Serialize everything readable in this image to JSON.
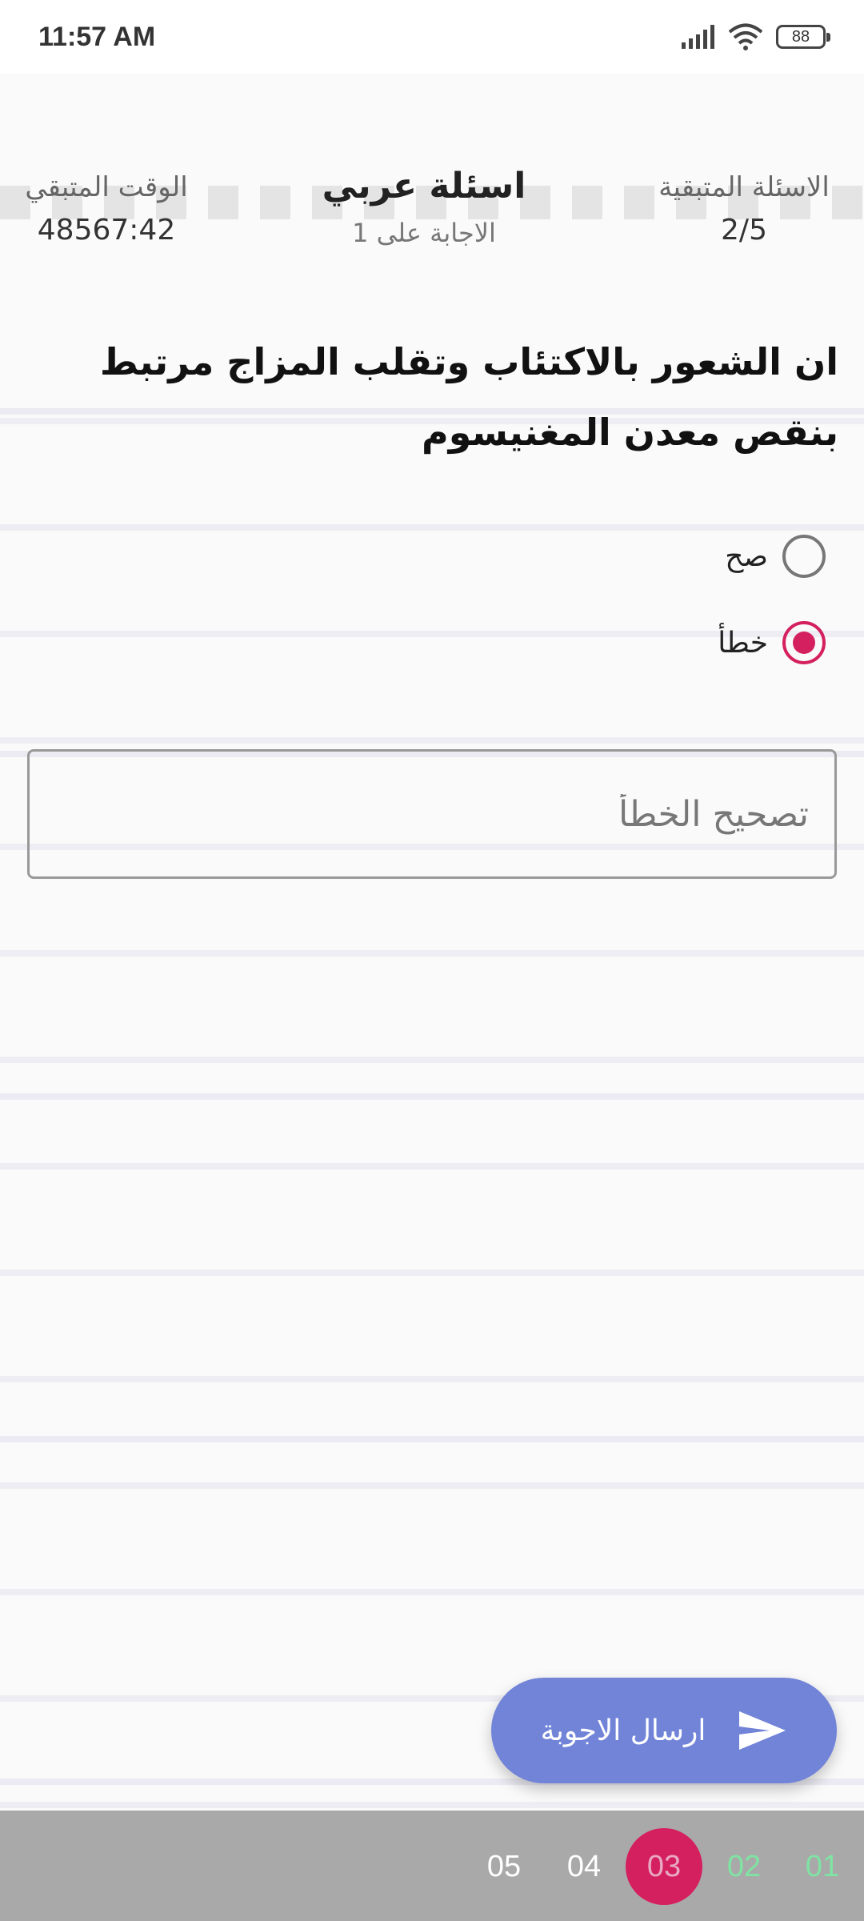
{
  "status_bar": {
    "time": "11:57 AM",
    "battery": "88"
  },
  "header": {
    "remaining_questions_label": "الاسئلة المتبقية",
    "remaining_questions_value": "2/5",
    "remaining_time_label": "الوقت المتبقي",
    "remaining_time_value": "48567:42",
    "title": "اسئلة عربي",
    "answer_note": "الاجابة على 1"
  },
  "question": {
    "text": "ان الشعور بالاكتئاب وتقلب المزاج مرتبط بنقص معدن المغنيسوم"
  },
  "options": [
    {
      "label": "صح",
      "selected": false
    },
    {
      "label": "خطأ",
      "selected": true
    }
  ],
  "correction": {
    "placeholder": "تصحيح الخطأ",
    "value": ""
  },
  "send_button": {
    "label": "ارسال الاجوبة",
    "icon": "send-icon"
  },
  "pages": [
    {
      "label": "05",
      "state": "todo"
    },
    {
      "label": "04",
      "state": "todo"
    },
    {
      "label": "03",
      "state": "current"
    },
    {
      "label": "02",
      "state": "done"
    },
    {
      "label": "01",
      "state": "done"
    }
  ],
  "colors": {
    "accent": "#d4205e",
    "button": "#7184d8",
    "done": "#7fe3a3",
    "nav_bar": "#a9a9a9"
  }
}
